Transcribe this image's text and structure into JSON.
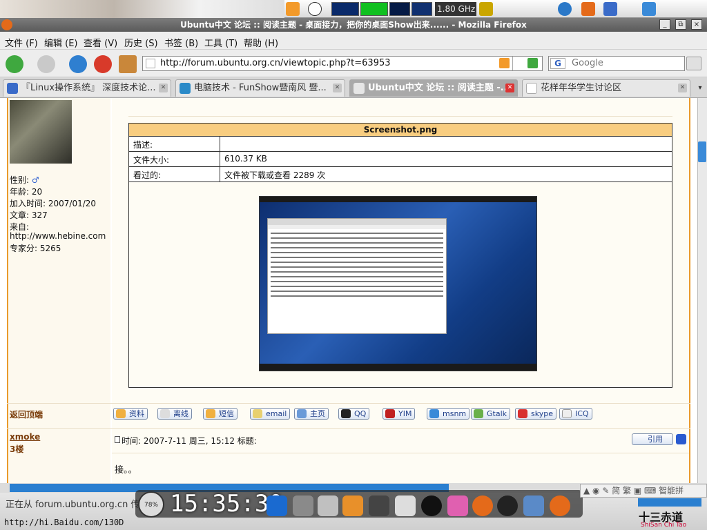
{
  "top_panel": {
    "cpu_freq": "1.80 GHz"
  },
  "window": {
    "title": "Ubuntu中文 论坛 :: 阅读主题 - 桌面接力，把你的桌面Show出来...... - Mozilla Firefox",
    "minimize": "_",
    "maximize": "⧉",
    "close": "×"
  },
  "menu": [
    "文件 (F)",
    "编辑 (E)",
    "查看 (V)",
    "历史 (S)",
    "书签 (B)",
    "工具 (T)",
    "帮助 (H)"
  ],
  "nav": {
    "url": "http://forum.ubuntu.org.cn/viewtopic.php?t=63953",
    "search_placeholder": "Google"
  },
  "tabs": [
    {
      "label": "『Linux操作系统』 深度技术论...",
      "active": false
    },
    {
      "label": "电脑技术 - FunShow暨南风 暨...",
      "active": false
    },
    {
      "label": "Ubuntu中文 论坛 :: 阅读主题 -...",
      "active": true
    },
    {
      "label": "花样年华学生讨论区",
      "active": false
    }
  ],
  "profile": {
    "gender": "性别:",
    "age": "年龄: 20",
    "joined": "加入时间: 2007/01/20",
    "posts": "文章: 327",
    "from_label": "来自:",
    "from_value": "http://www.hebine.com",
    "score": "专家分: 5265"
  },
  "attachment": {
    "filename": "Screenshot.png",
    "rows": [
      {
        "key": "描述:",
        "value": ""
      },
      {
        "key": "文件大小:",
        "value": "610.37 KB"
      },
      {
        "key": "看过的:",
        "value": "文件被下载或查看 2289 次"
      }
    ]
  },
  "post_footer": {
    "back_to_top": "返回顶端",
    "buttons": [
      "资料",
      "离线",
      "短信",
      "email",
      "主页",
      "QQ",
      "YIM",
      "msnm",
      "Gtalk",
      "skype",
      "ICQ"
    ]
  },
  "next_post": {
    "username": "xmoke",
    "floor": "3楼",
    "time": "时间: 2007-7-11 周三, 15:12    标题:",
    "quote": "引用",
    "body": "接。。"
  },
  "status": {
    "text": "正在从 forum.ubuntu.org.cn 传",
    "clock": "15:35:30",
    "gauge": "78%",
    "bottom_url": "http://hi.Baidu.com/130D",
    "sysbar": "智能拼",
    "brand": "十三赤道",
    "brand_sub": "ShiSan Chi Tao"
  }
}
